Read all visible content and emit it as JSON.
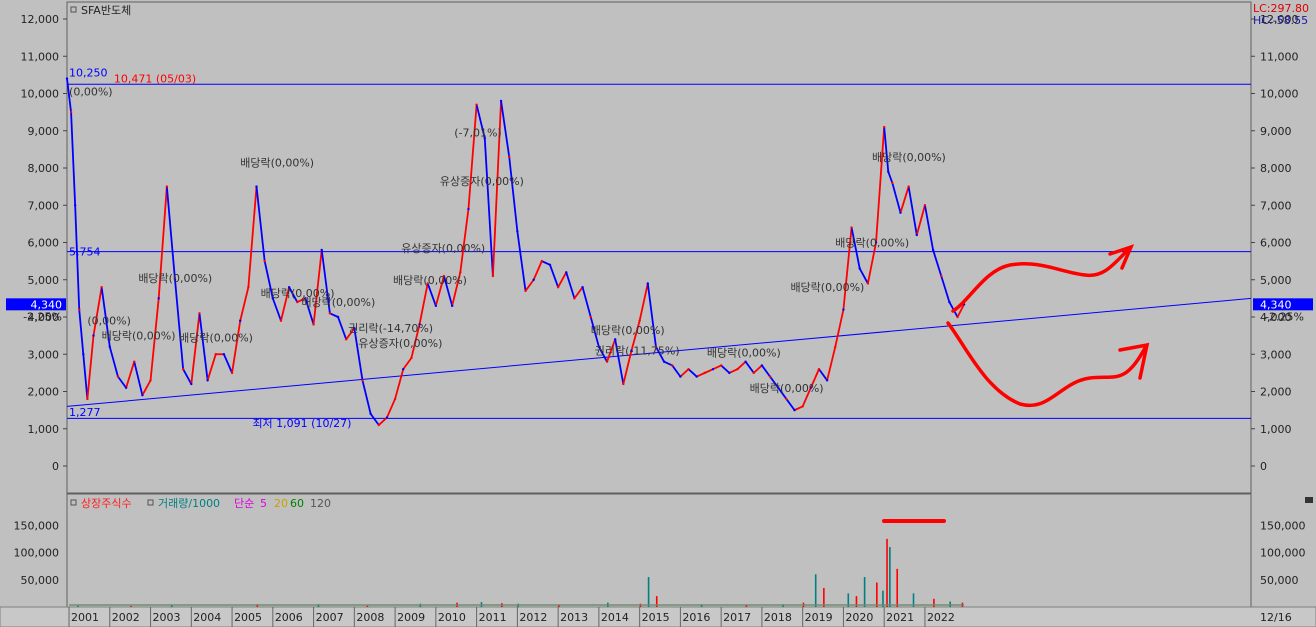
{
  "colors": {
    "background": "#c0c0c0",
    "price_up": "#ff0000",
    "price_down": "#0000ff",
    "trendline": "#0000ff",
    "annotation_red": "#ff0000",
    "badge_bg": "#0000ff",
    "volume_title": "#ff2020",
    "volume_series": "#008080",
    "ma5": "#e000e0",
    "ma20": "#c8a000",
    "ma60": "#008000",
    "ma120": "#555555"
  },
  "chart_data": [
    {
      "type": "line",
      "title": "SFA반도체",
      "ylim": [
        -1000,
        12500
      ],
      "yticks": [
        "12,000",
        "11,000",
        "10,000",
        "9,000",
        "8,000",
        "7,000",
        "6,000",
        "5,000",
        "4,000",
        "3,000",
        "2,000",
        "1,000",
        "0"
      ],
      "ytick_values": [
        12000,
        11000,
        10000,
        9000,
        8000,
        7000,
        6000,
        5000,
        4000,
        3000,
        2000,
        1000,
        0
      ],
      "x_year_labels": [
        "2001",
        "2002",
        "2003",
        "2004",
        "2005",
        "2006",
        "2007",
        "2008",
        "2009",
        "2010",
        "2011",
        "2012",
        "2013",
        "2014",
        "2015",
        "2016",
        "2017",
        "2018",
        "2019",
        "2020",
        "2021",
        "2022"
      ],
      "x_year_values": [
        2001,
        2002,
        2003,
        2004,
        2005,
        2006,
        2007,
        2008,
        2009,
        2010,
        2011,
        2012,
        2013,
        2014,
        2015,
        2016,
        2017,
        2018,
        2019,
        2020,
        2021,
        2022
      ],
      "x_last_label": "12/16",
      "xlim": [
        2000.95,
        2030.0
      ],
      "price_series": {
        "x": [
          2000.95,
          2001.05,
          2001.15,
          2001.25,
          2001.35,
          2001.45,
          2001.6,
          2001.8,
          2002.0,
          2002.2,
          2002.4,
          2002.6,
          2002.8,
          2003.0,
          2003.2,
          2003.4,
          2003.6,
          2003.8,
          2004.0,
          2004.2,
          2004.4,
          2004.6,
          2004.8,
          2005.0,
          2005.2,
          2005.4,
          2005.6,
          2005.8,
          2006.0,
          2006.2,
          2006.4,
          2006.6,
          2006.8,
          2007.0,
          2007.2,
          2007.4,
          2007.6,
          2007.8,
          2008.0,
          2008.2,
          2008.4,
          2008.6,
          2008.8,
          2009.0,
          2009.2,
          2009.4,
          2009.6,
          2009.8,
          2010.0,
          2010.2,
          2010.4,
          2010.6,
          2010.8,
          2011.0,
          2011.2,
          2011.4,
          2011.6,
          2011.8,
          2012.0,
          2012.2,
          2012.4,
          2012.6,
          2012.8,
          2013.0,
          2013.2,
          2013.4,
          2013.6,
          2013.8,
          2014.0,
          2014.2,
          2014.4,
          2014.6,
          2014.8,
          2015.0,
          2015.2,
          2015.4,
          2015.6,
          2015.8,
          2016.0,
          2016.2,
          2016.4,
          2016.6,
          2016.8,
          2017.0,
          2017.2,
          2017.4,
          2017.6,
          2017.8,
          2018.0,
          2018.2,
          2018.4,
          2018.6,
          2018.8,
          2019.0,
          2019.2,
          2019.4,
          2019.6,
          2019.8,
          2020.0,
          2020.2,
          2020.4,
          2020.6,
          2020.8,
          2021.0,
          2021.1,
          2021.2,
          2021.4,
          2021.6,
          2021.8,
          2022.0,
          2022.2,
          2022.4,
          2022.6,
          2022.8,
          2022.96
        ],
        "y": [
          10400,
          9500,
          7000,
          4200,
          3000,
          1800,
          3500,
          4800,
          3200,
          2400,
          2100,
          2800,
          1900,
          2300,
          4500,
          7500,
          5000,
          2600,
          2200,
          4100,
          2300,
          3000,
          3000,
          2500,
          3900,
          4800,
          7500,
          5500,
          4500,
          3900,
          4800,
          4400,
          4500,
          3800,
          5800,
          4100,
          4000,
          3400,
          3700,
          2300,
          1400,
          1100,
          1300,
          1800,
          2600,
          2900,
          3800,
          4900,
          4300,
          5100,
          4300,
          5200,
          6900,
          9700,
          8800,
          5100,
          9800,
          8300,
          6300,
          4700,
          5000,
          5500,
          5400,
          4800,
          5200,
          4500,
          4800,
          4000,
          3200,
          2800,
          3400,
          2200,
          3100,
          3900,
          4900,
          3200,
          2800,
          2700,
          2400,
          2600,
          2400,
          2500,
          2600,
          2700,
          2500,
          2600,
          2800,
          2500,
          2700,
          2400,
          2100,
          1800,
          1500,
          1600,
          2100,
          2600,
          2300,
          3200,
          4200,
          6400,
          5300,
          4900,
          6000,
          9100,
          7900,
          7600,
          6800,
          7500,
          6200,
          7000,
          5800,
          5100,
          4400,
          4000,
          4340
        ]
      },
      "trendline": {
        "x": [
          2000.95,
          2030.0
        ],
        "y": [
          1600,
          4500
        ]
      },
      "hlines": [
        10250,
        5754,
        1277
      ],
      "annotations": [
        {
          "text": "10,250",
          "x": 2001.0,
          "y": 10560,
          "color": "#0000ff"
        },
        {
          "text": "10,471 (05/03)",
          "x": 2002.1,
          "y": 10400,
          "color": "#ff0000"
        },
        {
          "text": "(0,00%)",
          "x": 2001.0,
          "y": 10050,
          "color": "#333333"
        },
        {
          "text": "5,754",
          "x": 2001.0,
          "y": 5754,
          "color": "#0000ff"
        },
        {
          "text": "1,277",
          "x": 2001.0,
          "y": 1450,
          "color": "#0000ff"
        },
        {
          "text": "최저 1,091 (10/27)",
          "x": 2005.5,
          "y": 1150,
          "color": "#0000ff"
        },
        {
          "text": "배당락(0,00%)",
          "x": 2005.2,
          "y": 8150,
          "color": "#333333"
        },
        {
          "text": "배당락(0,00%)",
          "x": 2002.7,
          "y": 5050,
          "color": "#333333"
        },
        {
          "text": "(0,00%)",
          "x": 2001.45,
          "y": 3900,
          "color": "#333333"
        },
        {
          "text": "배당락(0,00%)",
          "x": 2001.8,
          "y": 3500,
          "color": "#333333"
        },
        {
          "text": "배당락(0,00%)",
          "x": 2003.7,
          "y": 3450,
          "color": "#333333"
        },
        {
          "text": "배당락(0,00%)",
          "x": 2005.7,
          "y": 4650,
          "color": "#333333"
        },
        {
          "text": "배당락(0,00%)",
          "x": 2006.7,
          "y": 4400,
          "color": "#333333"
        },
        {
          "text": "권리락(-14,70%)",
          "x": 2007.85,
          "y": 3700,
          "color": "#333333"
        },
        {
          "text": "유상증자(0,00%)",
          "x": 2008.1,
          "y": 3300,
          "color": "#333333"
        },
        {
          "text": "유상증자(0,00%)",
          "x": 2009.15,
          "y": 5850,
          "color": "#333333"
        },
        {
          "text": "배당락(0,00%)",
          "x": 2008.95,
          "y": 5000,
          "color": "#333333"
        },
        {
          "text": "(-7,01%)",
          "x": 2010.45,
          "y": 8950,
          "color": "#333333"
        },
        {
          "text": "유상증자(0,00%)",
          "x": 2010.1,
          "y": 7650,
          "color": "#333333"
        },
        {
          "text": "배당락(0,00%)",
          "x": 2013.8,
          "y": 3650,
          "color": "#333333"
        },
        {
          "text": "권리락(-11,75%)",
          "x": 2013.9,
          "y": 3100,
          "color": "#333333"
        },
        {
          "text": "배당락(0,00%)",
          "x": 2016.65,
          "y": 3050,
          "color": "#333333"
        },
        {
          "text": "배당락(0,00%)",
          "x": 2017.7,
          "y": 2100,
          "color": "#333333"
        },
        {
          "text": "배당락(0,00%)",
          "x": 2018.7,
          "y": 4800,
          "color": "#333333"
        },
        {
          "text": "배당락(0,00%)",
          "x": 2019.8,
          "y": 6000,
          "color": "#333333"
        },
        {
          "text": "배당락(0,00%)",
          "x": 2020.7,
          "y": 8300,
          "color": "#333333"
        }
      ],
      "right_info": {
        "lc": "LC:297.80",
        "hc": "HC:-58.55"
      },
      "current_price_label": "4,340",
      "current_pct_label": "-2.25%",
      "current_price_value": 4340
    },
    {
      "type": "bar",
      "title": "상장주식수",
      "legend": [
        {
          "text": "거래량/1000",
          "color": "#008080"
        },
        {
          "text": "단순",
          "color": "#e000e0"
        },
        {
          "text": "5",
          "color": "#e000e0"
        },
        {
          "text": "20",
          "color": "#c8a000"
        },
        {
          "text": "60",
          "color": "#008000"
        },
        {
          "text": "120",
          "color": "#555555"
        }
      ],
      "ylim": [
        0,
        200000
      ],
      "yticks": [
        "150,000",
        "100,000",
        "50,000"
      ],
      "ytick_values": [
        150000,
        100000,
        50000
      ],
      "volume_points": {
        "x": [
          2001.2,
          2002.5,
          2003.5,
          2005.6,
          2007.1,
          2008.3,
          2009.6,
          2010.5,
          2011.1,
          2011.6,
          2012.0,
          2013.0,
          2014.2,
          2015.0,
          2015.2,
          2015.4,
          2016.5,
          2017.6,
          2018.5,
          2019.0,
          2019.3,
          2019.5,
          2020.1,
          2020.3,
          2020.5,
          2020.8,
          2020.95,
          2021.05,
          2021.12,
          2021.3,
          2021.7,
          2022.2,
          2022.6,
          2022.9
        ],
        "y": [
          3000,
          2000,
          4000,
          5000,
          5000,
          3000,
          6000,
          8000,
          9000,
          7000,
          6000,
          4000,
          8000,
          6000,
          55000,
          20000,
          5000,
          4000,
          5000,
          8000,
          60000,
          35000,
          25000,
          20000,
          55000,
          45000,
          30000,
          125000,
          110000,
          70000,
          25000,
          15000,
          10000,
          8000
        ]
      }
    }
  ]
}
